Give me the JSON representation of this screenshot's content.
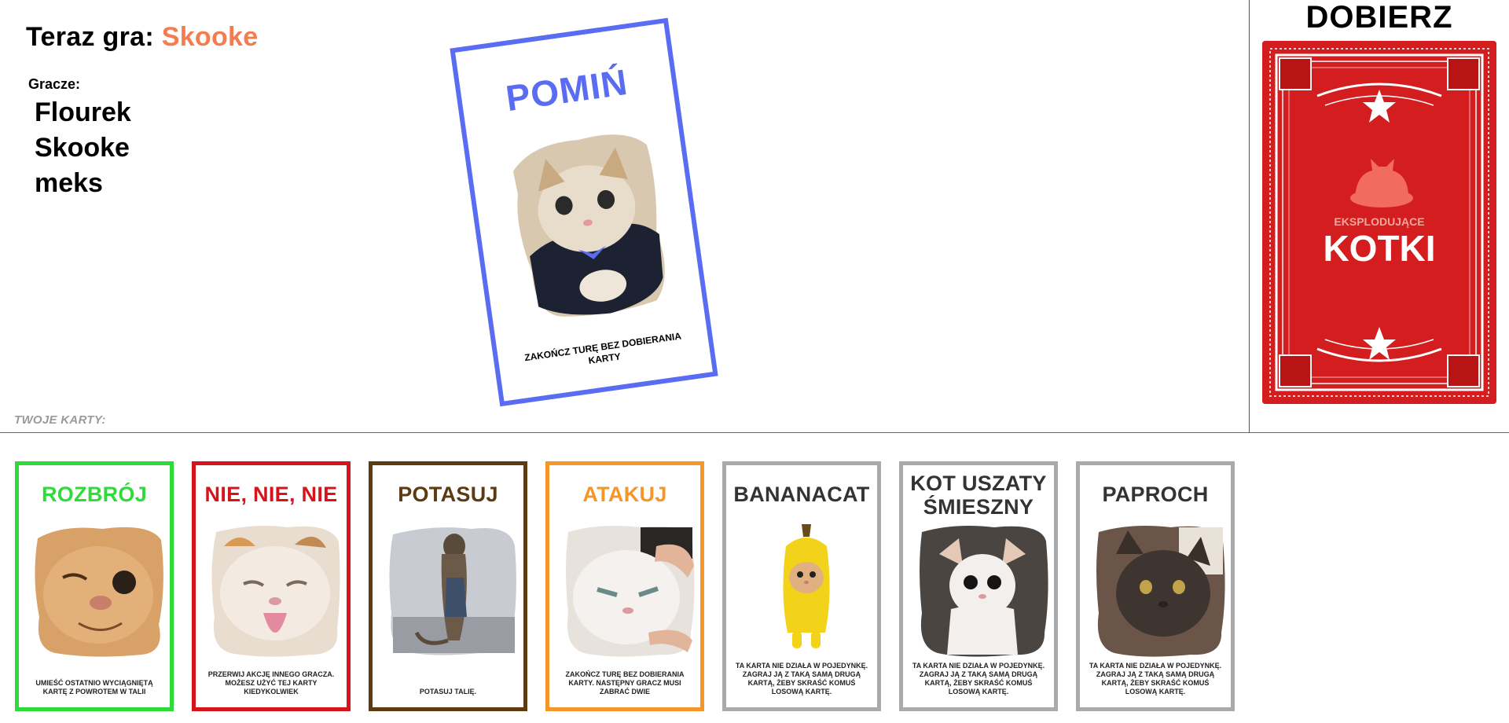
{
  "turn": {
    "prefix": "Teraz gra:",
    "current_player": "Skooke"
  },
  "players": {
    "title": "Gracze:",
    "list": [
      "Flourek",
      "Skooke",
      "meks"
    ]
  },
  "played_card": {
    "title": "POMIŃ",
    "description": "ZAKOŃCZ TURĘ BEZ DOBIERANIA KARTY",
    "color": "#5a6cf2"
  },
  "draw_pile": {
    "title": "DOBIERZ",
    "brand_top": "EKSPLODUJĄCE",
    "brand_main": "KOTKI",
    "color": "#d41d1f"
  },
  "hand": {
    "label": "TWOJE KARTY:",
    "cards": [
      {
        "title": "ROZBRÓJ",
        "description": "UMIEŚĆ OSTATNIO WYCIĄGNIĘTĄ KARTĘ Z POWROTEM W TALII",
        "color": "#2edb3a"
      },
      {
        "title": "NIE, NIE, NIE",
        "description": "PRZERWIJ AKCJĘ INNEGO GRACZA. MOŻESZ UŻYĆ TEJ KARTY KIEDYKOLWIEK",
        "color": "#d4151c"
      },
      {
        "title": "POTASUJ",
        "description": "POTASUJ TALIĘ.",
        "color": "#5c3a12"
      },
      {
        "title": "ATAKUJ",
        "description": "ZAKOŃCZ TURĘ BEZ DOBIERANIA KARTY. NASTĘPNY GRACZ MUSI ZABRAĆ DWIE",
        "color": "#f5962a"
      },
      {
        "title": "BANANACAT",
        "description": "TA KARTA NIE DZIAŁA W POJEDYNKĘ. ZAGRAJ JĄ Z TAKĄ SAMĄ DRUGĄ KARTĄ, ŻEBY SKRAŚĆ KOMUŚ LOSOWĄ KARTĘ.",
        "color": "#aaaaaa"
      },
      {
        "title": "KOT USZATY ŚMIESZNY",
        "description": "TA KARTA NIE DZIAŁA W POJEDYNKĘ. ZAGRAJ JĄ Z TAKĄ SAMĄ DRUGĄ KARTĄ, ŻEBY SKRAŚĆ KOMUŚ LOSOWĄ KARTĘ.",
        "color": "#aaaaaa"
      },
      {
        "title": "PAPROCH",
        "description": "TA KARTA NIE DZIAŁA W POJEDYNKĘ. ZAGRAJ JĄ Z TAKĄ SAMĄ DRUGĄ KARTĄ, ŻEBY SKRAŚĆ KOMUŚ LOSOWĄ KARTĘ.",
        "color": "#aaaaaa"
      }
    ]
  }
}
